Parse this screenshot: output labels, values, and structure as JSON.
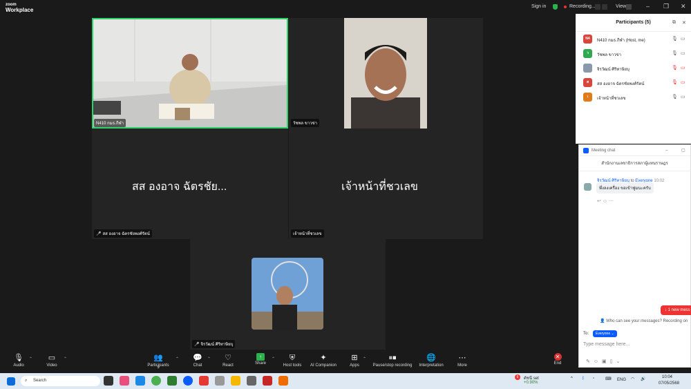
{
  "app": {
    "logo_line1": "zoom",
    "logo_line2": "Workplace"
  },
  "topbar": {
    "sign_in": "Sign in",
    "recording": "Recording...",
    "view": "View"
  },
  "tiles": {
    "host_name": "N410 กมธ.กีฬา",
    "t2_name": "วัชพล ขาวข่า",
    "t3_big": "สส องอาจ ฉัตรชัย...",
    "t3_name": "สส องอาจ ฉัตรชัยพงศ์รัตน์",
    "t4_big": "เจ้าหน้าที่ชวเลข",
    "t4_name": "เจ้าหน้าที่ชวเลข",
    "t5_name": "จิรวัฒน์ ศิริทาษิยบุ"
  },
  "toolbar": {
    "audio": "Audio",
    "video": "Video",
    "participants": "Participants",
    "participants_count": "5",
    "chat": "Chat",
    "react": "React",
    "share": "Share",
    "host_tools": "Host tools",
    "ai": "AI Companion",
    "apps": "Apps",
    "pause": "Pause/stop recording",
    "interpretation": "Interpretation",
    "more": "More",
    "end": "End"
  },
  "participants_panel": {
    "title": "Participants (5)",
    "items": [
      {
        "initials": "N4",
        "name": "N410 กมธ.กีฬา (Host, me)",
        "color": "#d9453b"
      },
      {
        "initials": "ว",
        "name": "วัชพล ขาวข่า",
        "color": "#2fa84f"
      },
      {
        "initials": "",
        "name": "จิรวัฒน์ ศิริทาษิยบุ",
        "color": "#8899aa"
      },
      {
        "initials": "ส",
        "name": "สส องอาจ ฉัตรชัยพงศ์รัตน์",
        "color": "#d9453b"
      },
      {
        "initials": "เ",
        "name": "เจ้าหน้าที่ชวเลข",
        "color": "#e07b18"
      }
    ]
  },
  "chat": {
    "header": "Meeting chat",
    "subheader": "สำนักงานเลขาธิการสภาผู้แทนราษฎร",
    "msg_from": "จิรวัฒน์ ศิริทาษิยบุ",
    "msg_to_word": "to",
    "msg_to": "Everyone",
    "msg_time": "10:02",
    "msg_text": "พึ่งลงเครื่อง ขอเข้าฟูมนะครับ",
    "new_messages": "1 new mess",
    "who_can_see": "Who can see your messages? Recording on",
    "to_label": "To:",
    "to_value": "Everyone",
    "placeholder": "Type message here..."
  },
  "taskbar": {
    "search": "Search",
    "stock_name": "ดัชนี set",
    "stock_change": "+0.90%",
    "stock_badge": "6",
    "lang": "ENG",
    "time": "10:04",
    "date": "07/05/2568"
  },
  "colors": {
    "accent": "#0b5cff",
    "active_speaker": "#2bd36b",
    "danger": "#e33333"
  }
}
